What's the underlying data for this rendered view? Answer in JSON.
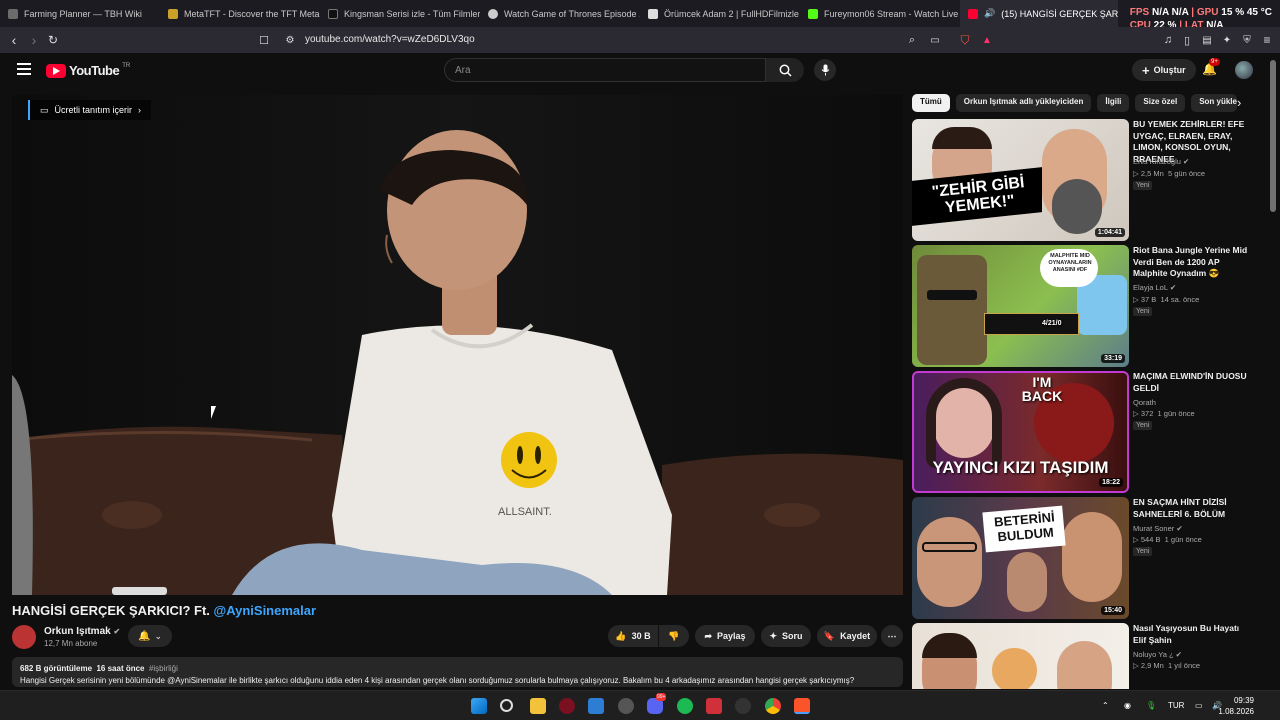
{
  "browser": {
    "tabs": [
      {
        "label": "Farming Planner — TBH Wiki",
        "color": "#6b6b6b"
      },
      {
        "label": "MetaTFT - Discover the TFT Meta w",
        "color": "#c9a227"
      },
      {
        "label": "Kingsman Serisi izle - Tüm Filmler |",
        "color": "#111111"
      },
      {
        "label": "Watch Game of Thrones Episode 1",
        "color": "#cccccc"
      },
      {
        "label": "Örümcek Adam 2 | FullHDFilmizle",
        "color": "#dddddd"
      },
      {
        "label": "Fureymon06 Stream - Watch Live o",
        "color": "#53fc18"
      }
    ],
    "active_tab": {
      "label": "(15) HANGİSİ GERÇEK ŞARKI",
      "close": "×"
    },
    "url": "youtube.com/watch?v=wZeD6DLV3qo",
    "hud": {
      "fps_label": "FPS",
      "fps_value": "N/A",
      "fps_value2": "N/A",
      "gpu_label": "GPU",
      "gpu_value": "15 %",
      "gpu_temp": "45 °C",
      "cpu_label": "CPU",
      "cpu_value": "22 %",
      "lat_label": "LAT",
      "lat_value": "N/A"
    }
  },
  "youtube": {
    "logo": "YouTube",
    "region": "TR",
    "search_placeholder": "Ara",
    "create_label": "Oluştur",
    "notif_count": "9+",
    "promo_label": "Ücretli tanıtım içerir",
    "video_title": "HANGİSİ GERÇEK ŞARKICI? Ft.",
    "video_title_mention": "@AyniSinemalar",
    "channel_name": "Orkun Işıtmak",
    "subscribers": "12,7 Mn abone",
    "likes": "30 B",
    "share_label": "Paylaş",
    "ask_label": "Soru",
    "save_label": "Kaydet",
    "views": "682 B görüntüleme",
    "uploaded": "16 saat önce",
    "hashtag": "#işbirliği",
    "description": "Hangisi Gerçek serisinin yeni bölümünde @AyniSinemalar ile birlikte şarkıcı olduğunu iddia eden 4 kişi arasından gerçek olanı sorduğumuz sorularla bulmaya çalışıyoruz. Bakalım bu 4 arkadaşımız arasından hangisi gerçek şarkıcıymış?",
    "chips": [
      "Tümü",
      "Orkun Işıtmak adlı yükleyiciden",
      "İlgili",
      "Size özel",
      "Son yüklen"
    ],
    "recommendations": [
      {
        "title": "BU YEMEK ZEHİRLER! EFE UYGAÇ, ELRAEN, ERAY, LIMON, KONSOL OYUN, RRAENEE",
        "channel": "Enis Kirazoglu",
        "views": "2,5 Mn",
        "age": "5 gün önce",
        "badge": "Yeni",
        "duration": "1:04:41",
        "thumb_text": "\"ZEHİR GİBİ YEMEK!\""
      },
      {
        "title": "Riot Bana Jungle Yerine Mid Verdi Ben de 1200 AP Malphite Oynadım 😎",
        "channel": "Elayja LoL",
        "views": "37 B",
        "age": "14 sa. önce",
        "badge": "Yeni",
        "duration": "33:19",
        "thumb_text": "MALPHITE MID OYNAYANLARIN ANASINI #DF",
        "thumb_score": "4/21/0"
      },
      {
        "title": "MAÇIMA ELWIND'İN DUOSU GELDİ",
        "channel": "Qorath",
        "views": "372",
        "age": "1 gün önce",
        "badge": "Yeni",
        "duration": "18:22",
        "thumb_text": "YAYINCI KIZI TAŞIDIM",
        "thumb_text2": "I'M BACK"
      },
      {
        "title": "EN SAÇMA HİNT DİZİSİ SAHNELERİ 6. BÖLÜM",
        "channel": "Murat Soner",
        "views": "544 B",
        "age": "1 gün önce",
        "badge": "Yeni",
        "duration": "15:40",
        "thumb_text": "BETERİNİ BULDUM"
      },
      {
        "title": "Nasıl Yaşıyosun Bu Hayatı Elif Şahin",
        "channel": "Noluyo Ya ¿",
        "views": "2,9 Mn",
        "age": "1 yıl önce",
        "badge": "",
        "duration": "",
        "thumb_text": ""
      }
    ]
  },
  "taskbar": {
    "lang": "TUR",
    "time": "09:39",
    "date": "1.08.2026",
    "discord_badge": "99+"
  },
  "colors": {
    "accent": "#3ea6ff",
    "yt_red": "#ff0033",
    "bg": "#0f0f0f"
  }
}
